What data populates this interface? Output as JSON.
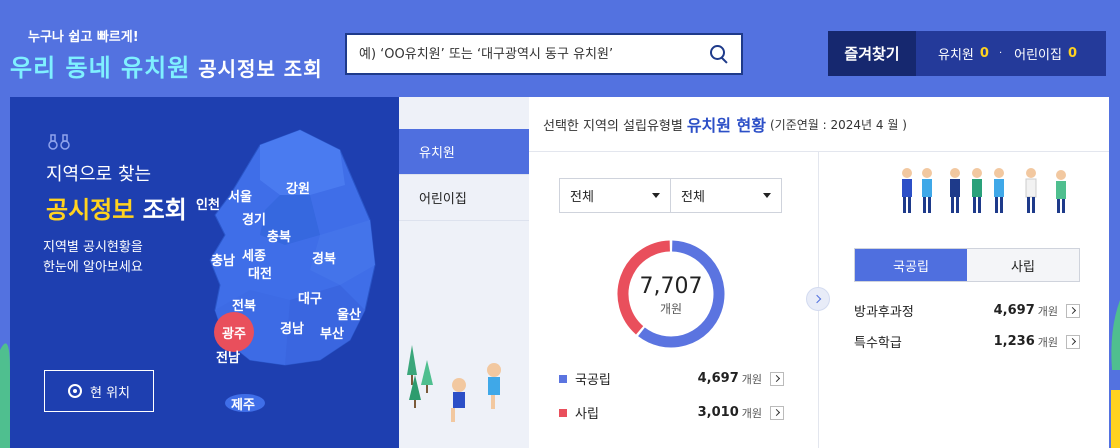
{
  "header": {
    "tagline": "누구나 쉽고 빠르게!",
    "title_part1": "우리 동네 ",
    "title_hl": "유치원",
    "title_part2": " 공시정보 조회"
  },
  "search": {
    "placeholder": "예) ‘OO유치원’ 또는 ‘대구광역시 동구 유치원’"
  },
  "favorites": {
    "button_label": "즐겨찾기",
    "items": [
      {
        "label": "유치원",
        "count": "0"
      },
      {
        "label": "어린이집",
        "count": "0"
      }
    ],
    "separator": "·"
  },
  "map_panel": {
    "heading_line1": "지역으로 찾는",
    "heading_hl": "공시정보",
    "heading_rest": " 조회",
    "desc_line1": "지역별 공시현황을",
    "desc_line2": "한눈에 알아보세요",
    "location_button": "현 위치",
    "regions": [
      "인천",
      "서울",
      "강원",
      "경기",
      "충북",
      "충남",
      "세종",
      "경북",
      "대전",
      "대구",
      "전북",
      "울산",
      "광주",
      "경남",
      "부산",
      "전남",
      "제주"
    ],
    "active_region": "광주"
  },
  "tabs": [
    {
      "label": "유치원",
      "active": true
    },
    {
      "label": "어린이집",
      "active": false
    }
  ],
  "main": {
    "heading_prefix": "선택한 지역의 설립유형별",
    "heading_hl": "유치원 현황",
    "heading_suffix": "(기준연월 : 2024년 4 월 )",
    "select1": "전체",
    "select2": "전체",
    "total": "7,707",
    "total_unit": "개원",
    "legend": [
      {
        "label": "국공립",
        "value": "4,697",
        "unit": "개원",
        "color": "#5b74e0"
      },
      {
        "label": "사립",
        "value": "3,010",
        "unit": "개원",
        "color": "#e94f5c"
      }
    ],
    "public_tabs": [
      {
        "label": "국공립",
        "active": true
      },
      {
        "label": "사립",
        "active": false
      }
    ],
    "public_rows": [
      {
        "label": "방과후과정",
        "value": "4,697",
        "unit": "개원"
      },
      {
        "label": "특수학급",
        "value": "1,236",
        "unit": "개원"
      }
    ]
  },
  "chart_data": {
    "type": "pie",
    "categories": [
      "국공립",
      "사립"
    ],
    "values": [
      4697,
      3010
    ],
    "colors": [
      "#5b74e0",
      "#e94f5c"
    ],
    "donut": true
  }
}
